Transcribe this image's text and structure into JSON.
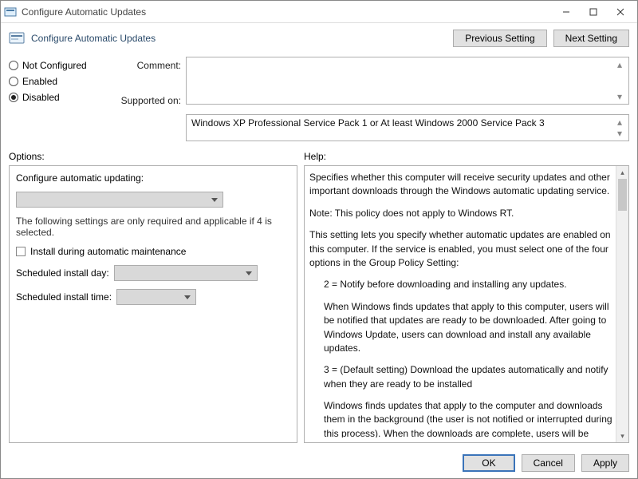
{
  "titlebar": {
    "title": "Configure Automatic Updates"
  },
  "header": {
    "title": "Configure Automatic Updates",
    "prev": "Previous Setting",
    "next": "Next Setting"
  },
  "radios": {
    "not_configured": "Not Configured",
    "enabled": "Enabled",
    "disabled": "Disabled"
  },
  "labels": {
    "comment": "Comment:",
    "supported": "Supported on:",
    "options": "Options:",
    "help": "Help:"
  },
  "supported_text": "Windows XP Professional Service Pack 1 or At least Windows 2000 Service Pack 3",
  "options": {
    "configure_label": "Configure automatic updating:",
    "note": "The following settings are only required and applicable if 4 is selected.",
    "install_maint": "Install during automatic maintenance",
    "sched_day": "Scheduled install day:",
    "sched_time": "Scheduled install time:"
  },
  "help": {
    "p1": "Specifies whether this computer will receive security updates and other important downloads through the Windows automatic updating service.",
    "p2": "Note: This policy does not apply to Windows RT.",
    "p3": "This setting lets you specify whether automatic updates are enabled on this computer. If the service is enabled, you must select one of the four options in the Group Policy Setting:",
    "p4": "2 = Notify before downloading and installing any updates.",
    "p5": "When Windows finds updates that apply to this computer, users will be notified that updates are ready to be downloaded. After going to Windows Update, users can download and install any available updates.",
    "p6": "3 = (Default setting) Download the updates automatically and notify when they are ready to be installed",
    "p7": "Windows finds updates that apply to the computer and downloads them in the background (the user is not notified or interrupted during this process). When the downloads are complete, users will be notified that they are ready to"
  },
  "footer": {
    "ok": "OK",
    "cancel": "Cancel",
    "apply": "Apply"
  }
}
